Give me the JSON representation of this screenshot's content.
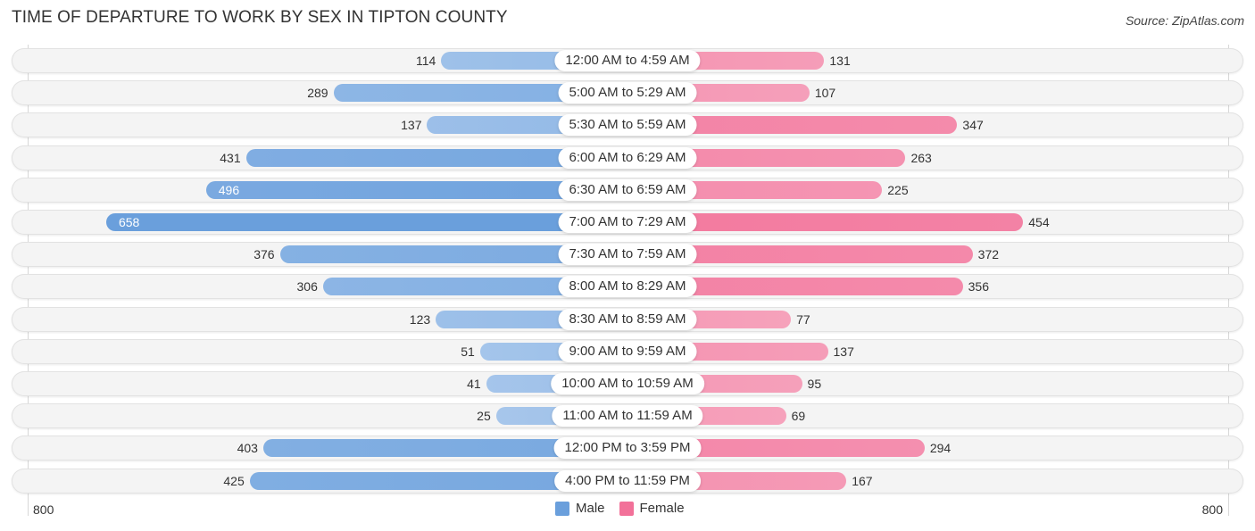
{
  "header": {
    "title": "TIME OF DEPARTURE TO WORK BY SEX IN TIPTON COUNTY",
    "source": "Source: ZipAtlas.com"
  },
  "colors": {
    "male": "#6a9fdc",
    "male_light": "#a9c8ec",
    "female": "#f27199",
    "female_light": "#f6a8c0"
  },
  "legend": {
    "male": "Male",
    "female": "Female"
  },
  "axis": {
    "left_label": "800",
    "right_label": "800"
  },
  "chart_data": {
    "type": "bar",
    "orientation": "horizontal-diverging",
    "title": "TIME OF DEPARTURE TO WORK BY SEX IN TIPTON COUNTY",
    "xlabel": "",
    "ylabel": "",
    "xlim": [
      -800,
      800
    ],
    "legend_position": "bottom-center",
    "categories": [
      "12:00 AM to 4:59 AM",
      "5:00 AM to 5:29 AM",
      "5:30 AM to 5:59 AM",
      "6:00 AM to 6:29 AM",
      "6:30 AM to 6:59 AM",
      "7:00 AM to 7:29 AM",
      "7:30 AM to 7:59 AM",
      "8:00 AM to 8:29 AM",
      "8:30 AM to 8:59 AM",
      "9:00 AM to 9:59 AM",
      "10:00 AM to 10:59 AM",
      "11:00 AM to 11:59 AM",
      "12:00 PM to 3:59 PM",
      "4:00 PM to 11:59 PM"
    ],
    "series": [
      {
        "name": "Male",
        "values": [
          114,
          289,
          137,
          431,
          496,
          658,
          376,
          306,
          123,
          51,
          41,
          25,
          403,
          425
        ]
      },
      {
        "name": "Female",
        "values": [
          131,
          107,
          347,
          263,
          225,
          454,
          372,
          356,
          77,
          137,
          95,
          69,
          294,
          167
        ]
      }
    ]
  }
}
